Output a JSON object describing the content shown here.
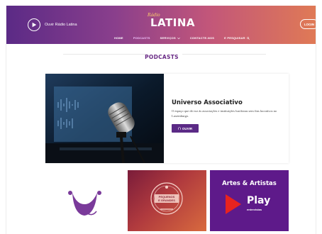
{
  "header": {
    "listen_label": "Ouvir Rádio Latina",
    "logo_small": "Rádio",
    "logo_big": "LATINA",
    "login_label": "LOGIN"
  },
  "nav": {
    "items": [
      {
        "label": "HOME"
      },
      {
        "label": "PODCASTS"
      },
      {
        "label": "SERVIÇOS"
      },
      {
        "label": "CONTACTE-NOS"
      },
      {
        "label": "E PESQUISAR"
      }
    ]
  },
  "section": {
    "title": "PODCASTS"
  },
  "featured": {
    "title": "Universo Associativo",
    "description": "O espaço que dá voz às associações e instituições lusófonas sem fins lucrativos no Luxemburgo.",
    "button_label": "OUVIR"
  },
  "cards": {
    "card2_badge_line1": "PEQUENOS",
    "card2_badge_line2": "E GRANDES",
    "card3_title": "Artes & Artistas",
    "card3_play": "Play",
    "card3_sub": "entrevistas"
  },
  "colors": {
    "brand_purple": "#5b2a86",
    "gradient_end": "#e07a55"
  }
}
